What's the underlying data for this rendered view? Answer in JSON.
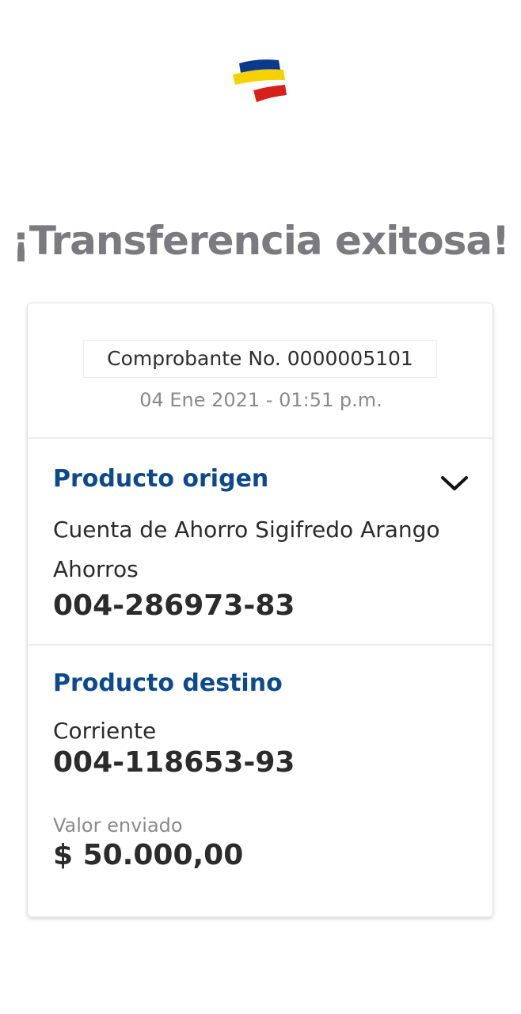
{
  "header": {
    "logo_icon": "bank-flag-logo-icon",
    "logo_colors": [
      "#0a3a8c",
      "#f6d100",
      "#d6201c"
    ]
  },
  "title": "¡Transferencia exitosa!",
  "receipt": {
    "number_label": "Comprobante No. 0000005101",
    "datetime": "04 Ene 2021 - 01:51 p.m."
  },
  "origin": {
    "title": "Producto origen",
    "account_name": "Cuenta de Ahorro Sigifredo Arango",
    "account_type": "Ahorros",
    "account_number": "004-286973-83",
    "toggle_icon": "chevron-down-icon"
  },
  "destination": {
    "title": "Producto destino",
    "account_type": "Corriente",
    "account_number": "004-118653-93"
  },
  "amount": {
    "label": "Valor enviado",
    "value": "$ 50.000,00"
  },
  "colors": {
    "accent": "#0d4a8c",
    "title_gray": "#7b7b7f",
    "text_dark": "#2b2b2b",
    "text_muted": "#8a8a8a"
  }
}
